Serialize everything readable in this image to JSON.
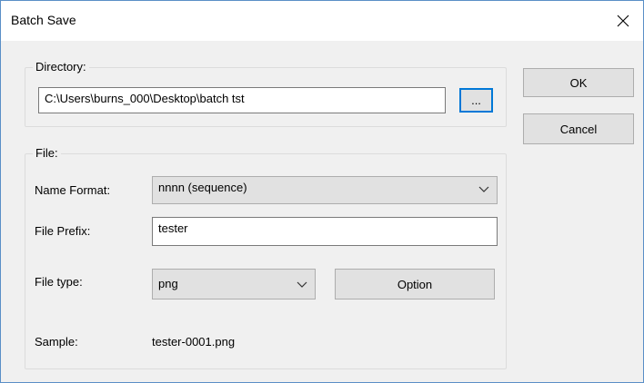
{
  "window": {
    "title": "Batch Save"
  },
  "directory": {
    "group_label": "Directory:",
    "path_value": "C:\\Users\\burns_000\\Desktop\\batch tst",
    "browse_label": "..."
  },
  "buttons": {
    "ok_label": "OK",
    "cancel_label": "Cancel"
  },
  "file": {
    "group_label": "File:",
    "name_format_label": "Name Format:",
    "name_format_value": "nnnn (sequence)",
    "prefix_label": "File Prefix:",
    "prefix_value": "tester",
    "type_label": "File type:",
    "type_value": "png",
    "option_label": "Option",
    "sample_label": "Sample:",
    "sample_value": "tester-0001.png"
  },
  "icons": {
    "close": "close-icon",
    "dropdown": "chevron-down-icon"
  },
  "colors": {
    "focus": "#0078d7",
    "window_border": "#5a8fc7",
    "button_bg": "#e1e1e1"
  }
}
